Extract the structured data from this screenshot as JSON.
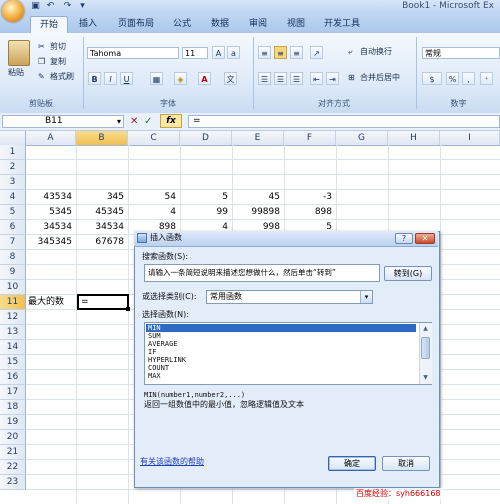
{
  "window": {
    "title": "Book1 - Microsoft Ex"
  },
  "tabs": [
    "开始",
    "插入",
    "页面布局",
    "公式",
    "数据",
    "审阅",
    "视图",
    "开发工具"
  ],
  "ribbon": {
    "clipboard": {
      "paste": "粘贴",
      "cut": "剪切",
      "copy": "复制",
      "format_painter": "格式刷",
      "label": "剪贴板"
    },
    "font": {
      "font_name": "Tahoma",
      "font_size": "11",
      "label": "字体",
      "bold": "B",
      "italic": "I",
      "underline": "U"
    },
    "alignment": {
      "wrap_text": "自动换行",
      "merge_center": "合并后居中",
      "label": "对齐方式"
    },
    "number": {
      "format": "常规",
      "label": "数字",
      "percent": "%",
      "comma": ","
    }
  },
  "formula_bar": {
    "name_box": "B11",
    "fx_label": "fx",
    "content": "="
  },
  "grid": {
    "columns": [
      "A",
      "B",
      "C",
      "D",
      "E",
      "F",
      "G",
      "H",
      "I"
    ],
    "rows": [
      "1",
      "2",
      "3",
      "4",
      "5",
      "6",
      "7",
      "8",
      "9",
      "10",
      "11",
      "12",
      "13",
      "14",
      "15",
      "16",
      "17",
      "18",
      "19",
      "20",
      "21",
      "22",
      "23"
    ],
    "data": {
      "row4": [
        "43534",
        "345",
        "54",
        "5",
        "45",
        "-3"
      ],
      "row5": [
        "5345",
        "45345",
        "4",
        "99",
        "99898",
        "898"
      ],
      "row6": [
        "34534",
        "34534",
        "898",
        "4",
        "998",
        "5"
      ],
      "row7": [
        "345345",
        "67678"
      ],
      "a11": "最大的数",
      "b11": "="
    }
  },
  "dialog": {
    "title": "插入函数",
    "search_label": "搜索函数(S):",
    "search_value": "请输入一条简短说明来描述您想做什么，然后单击“转到”",
    "go_button": "转到(G)",
    "category_label": "或选择类别(C):",
    "category_value": "常用函数",
    "select_label": "选择函数(N):",
    "functions": [
      "MIN",
      "SUM",
      "AVERAGE",
      "IF",
      "HYPERLINK",
      "COUNT",
      "MAX"
    ],
    "signature": "MIN(number1,number2,...)",
    "description": "返回一组数值中的最小值，忽略逻辑值及文本",
    "help_link": "有关该函数的帮助",
    "ok_button": "确定",
    "cancel_button": "取消"
  },
  "watermark": "百度经验：syh666168",
  "colors": {
    "selected": "#316ac5",
    "accent": "#15315c"
  }
}
